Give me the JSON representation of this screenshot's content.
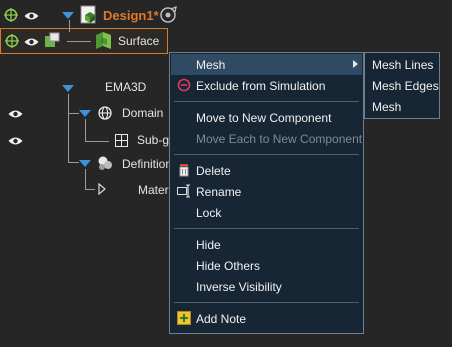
{
  "tree": {
    "design_label": "Design1*",
    "surface_label": "Surface",
    "ema3d_label": "EMA3D",
    "domain_label": "Domain",
    "subgrid_label": "Sub-g",
    "definitions_label": "Definition",
    "materials_label": "Mater"
  },
  "context_menu": {
    "items": [
      {
        "label": "Mesh"
      },
      {
        "label": "Exclude from Simulation"
      },
      {
        "label": "Move to New Component"
      },
      {
        "label": "Move Each to New Component"
      },
      {
        "label": "Delete"
      },
      {
        "label": "Rename"
      },
      {
        "label": "Lock"
      },
      {
        "label": "Hide"
      },
      {
        "label": "Hide Others"
      },
      {
        "label": "Inverse Visibility"
      },
      {
        "label": "Add Note"
      }
    ]
  },
  "submenu": {
    "items": [
      {
        "label": "Mesh Lines"
      },
      {
        "label": "Mesh Edges"
      },
      {
        "label": "Mesh"
      }
    ]
  },
  "colors": {
    "highlight": "#2f4a63",
    "accent_orange": "#e07a2b",
    "menu_bg": "#172634"
  }
}
